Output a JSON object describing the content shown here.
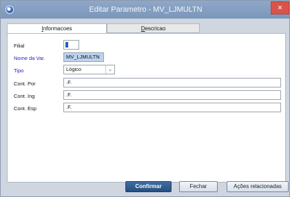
{
  "window": {
    "title": "Editar Parametro - MV_LJMULTN",
    "close_glyph": "×"
  },
  "tabs": [
    {
      "label_prefix": "",
      "label_u": "I",
      "label_rest": "nformacoes",
      "active": true
    },
    {
      "label_prefix": "",
      "label_u": "D",
      "label_rest": "escricao",
      "active": false
    }
  ],
  "form": {
    "filial_label": "Filial",
    "filial_value": "",
    "nome_label": "Nome da Var.",
    "nome_value": "MV_LJMULTN",
    "tipo_label": "Tipo",
    "tipo_value": "Lógico",
    "cont_por_label": "Cont. Por",
    "cont_por_value": ".F.",
    "cont_ing_label": "Cont. Ing",
    "cont_ing_value": ".F.",
    "cont_esp_label": "Cont. Esp",
    "cont_esp_value": ".F."
  },
  "buttons": {
    "confirm": "Confirmar",
    "close": "Fechar",
    "actions": "Ações relacionadas"
  },
  "colors": {
    "titlebar": "#8fa7c8",
    "close": "#d9534a",
    "primary_button": "#274f80",
    "label_blue": "#2222c8"
  },
  "icons": [
    "app-icon",
    "close-icon",
    "chevron-down-icon"
  ]
}
